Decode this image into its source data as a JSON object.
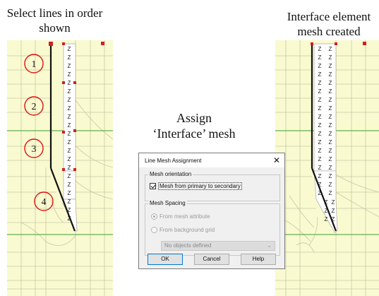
{
  "captions": {
    "left": "Select lines in order shown",
    "middle_line1": "Assign",
    "middle_line2": "‘Interface’ mesh",
    "right": "Interface element mesh created"
  },
  "left_panel": {
    "markers": [
      "1",
      "2",
      "3",
      "4"
    ],
    "element_label": "Z"
  },
  "right_panel": {
    "element_label": "Z"
  },
  "dialog": {
    "title": "Line Mesh Assignment",
    "close_glyph": "✕",
    "orientation_group": "Mesh orientation",
    "orientation_checkbox": "Mesh from primary to secondary",
    "spacing_group": "Mesh Spacing",
    "radio_mesh_attribute": "From mesh attribute",
    "radio_background_grid": "From background grid",
    "objects_select": "No objects defined",
    "ok": "OK",
    "cancel": "Cancel",
    "help": "Help"
  },
  "colors": {
    "mesh_fill": "#fafad0",
    "mesh_lines": "#c7c7a8",
    "green_line": "#5fb04f",
    "primary_line": "#111111",
    "node_red": "#cc2222",
    "marker_red": "#dd1111"
  }
}
